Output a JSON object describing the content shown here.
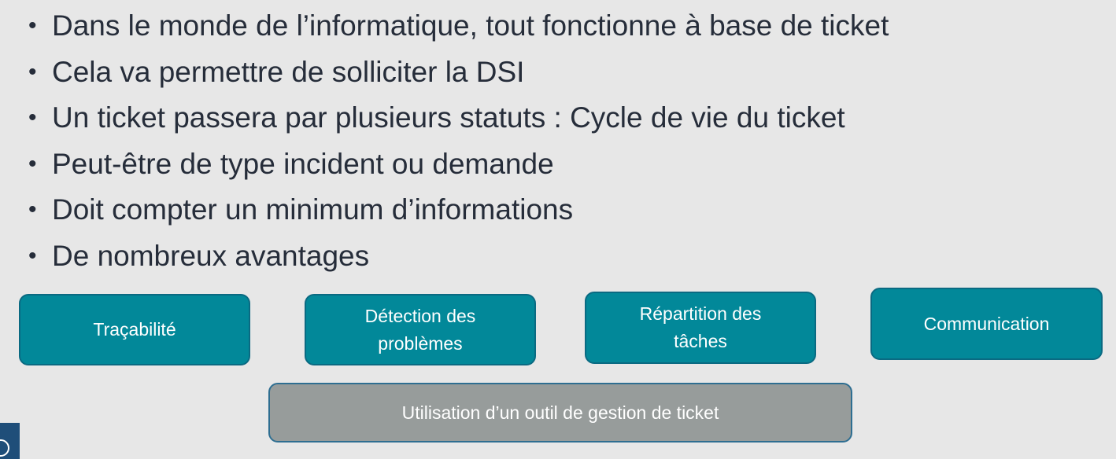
{
  "bullets": [
    "Dans le monde de l’informatique, tout fonctionne à base de ticket",
    "Cela va permettre de solliciter la DSI",
    "Un ticket passera par plusieurs statuts : Cycle de vie du ticket",
    "Peut-être de type incident ou demande",
    "Doit compter un minimum d’informations",
    "De nombreux avantages"
  ],
  "bullet_glyph": "•",
  "advantages": [
    {
      "line1": "Traçabilité",
      "line2": ""
    },
    {
      "line1": "Détection des",
      "line2": "problèmes"
    },
    {
      "line1": "Répartition des",
      "line2": "tâches"
    },
    {
      "line1": "Communication",
      "line2": ""
    }
  ],
  "tool_box": "Utilisation d’un outil de gestion de ticket",
  "colors": {
    "background": "#e7e7e7",
    "text": "#262d3a",
    "advantage_box": "#028899",
    "tool_box": "#979c9b",
    "corner_tab": "#1f4e79"
  }
}
